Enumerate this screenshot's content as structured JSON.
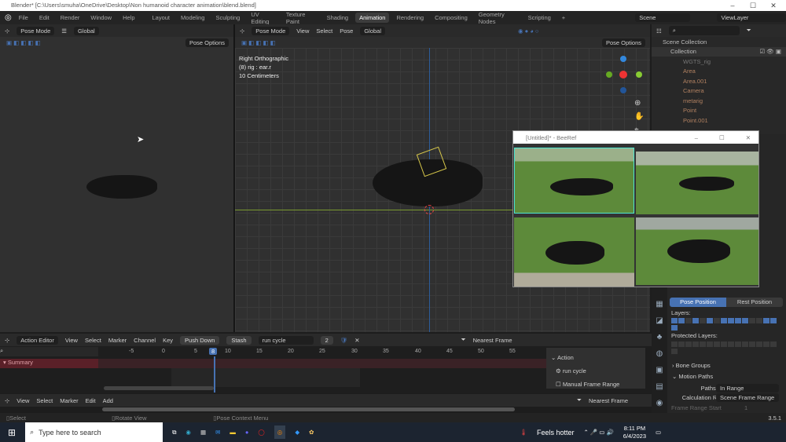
{
  "window": {
    "title": "Blender* [C:\\Users\\smuha\\OneDrive\\Desktop\\Non humanoid character animation\\blend.blend]",
    "minimize": "–",
    "maximize": "☐",
    "close": "✕"
  },
  "menu": [
    "File",
    "Edit",
    "Render",
    "Window",
    "Help"
  ],
  "workspaces": [
    "Layout",
    "Modeling",
    "Sculpting",
    "UV Editing",
    "Texture Paint",
    "Shading",
    "Animation",
    "Rendering",
    "Compositing",
    "Geometry Nodes",
    "Scripting",
    "+"
  ],
  "active_workspace": "Animation",
  "scene": "Scene",
  "view_layer": "ViewLayer",
  "left_viewport": {
    "mode": "Pose Mode",
    "orientation": "Global",
    "pose_options": "Pose Options"
  },
  "main_viewport": {
    "mode": "Pose Mode",
    "menus": [
      "View",
      "Select",
      "Pose"
    ],
    "orientation": "Global",
    "pose_options": "Pose Options",
    "overlay": [
      "Right Orthographic",
      "(8) rig : ear.r",
      "10 Centimeters"
    ]
  },
  "outliner": {
    "root": "Scene Collection",
    "collection": "Collection",
    "items": [
      "WGTS_rig",
      "Area",
      "Area.001",
      "Camera",
      "metarig",
      "Point",
      "Point.001"
    ]
  },
  "beeref": {
    "title": "[Untitled]* - BeeRef",
    "minimize": "–",
    "maximize": "☐",
    "close": "✕"
  },
  "properties": {
    "pose_position": "Pose Position",
    "rest_position": "Rest Position",
    "layers": "Layers:",
    "protected_layers": "Protected Layers:",
    "bone_groups": "Bone Groups",
    "motion_paths": "Motion Paths",
    "paths_type_label": "Paths Type",
    "paths_type": "In Range",
    "calc_range_label": "Calculation Range",
    "calc_range": "Scene Frame Range",
    "frame_range_start": "Frame Range Start",
    "frame_start_val": "1",
    "version": "3.5.1"
  },
  "action_editor": {
    "mode": "Action Editor",
    "menus": [
      "View",
      "Select",
      "Marker",
      "Channel",
      "Key"
    ],
    "push_down": "Push Down",
    "stash": "Stash",
    "action": "run cycle",
    "users": "2",
    "snap": "Nearest Frame",
    "summary": "Summary",
    "ticks": [
      "-5",
      "0",
      "5",
      "8",
      "10",
      "15",
      "20",
      "25",
      "30",
      "35",
      "40",
      "45",
      "50",
      "55"
    ],
    "current_frame": 8,
    "panel_title": "Action",
    "panel_action": "run cycle",
    "manual_range": "Manual Frame Range"
  },
  "timeline": {
    "menus": [
      "View",
      "Select",
      "Marker",
      "Edit",
      "Add"
    ],
    "snap": "Nearest Frame"
  },
  "statusbar": {
    "select": "Select",
    "rotate": "Rotate View",
    "context": "Pose Context Menu"
  },
  "taskbar": {
    "search": "Type here to search",
    "weather": "Feels hotter",
    "time": "8:11 PM",
    "date": "6/4/2023"
  }
}
